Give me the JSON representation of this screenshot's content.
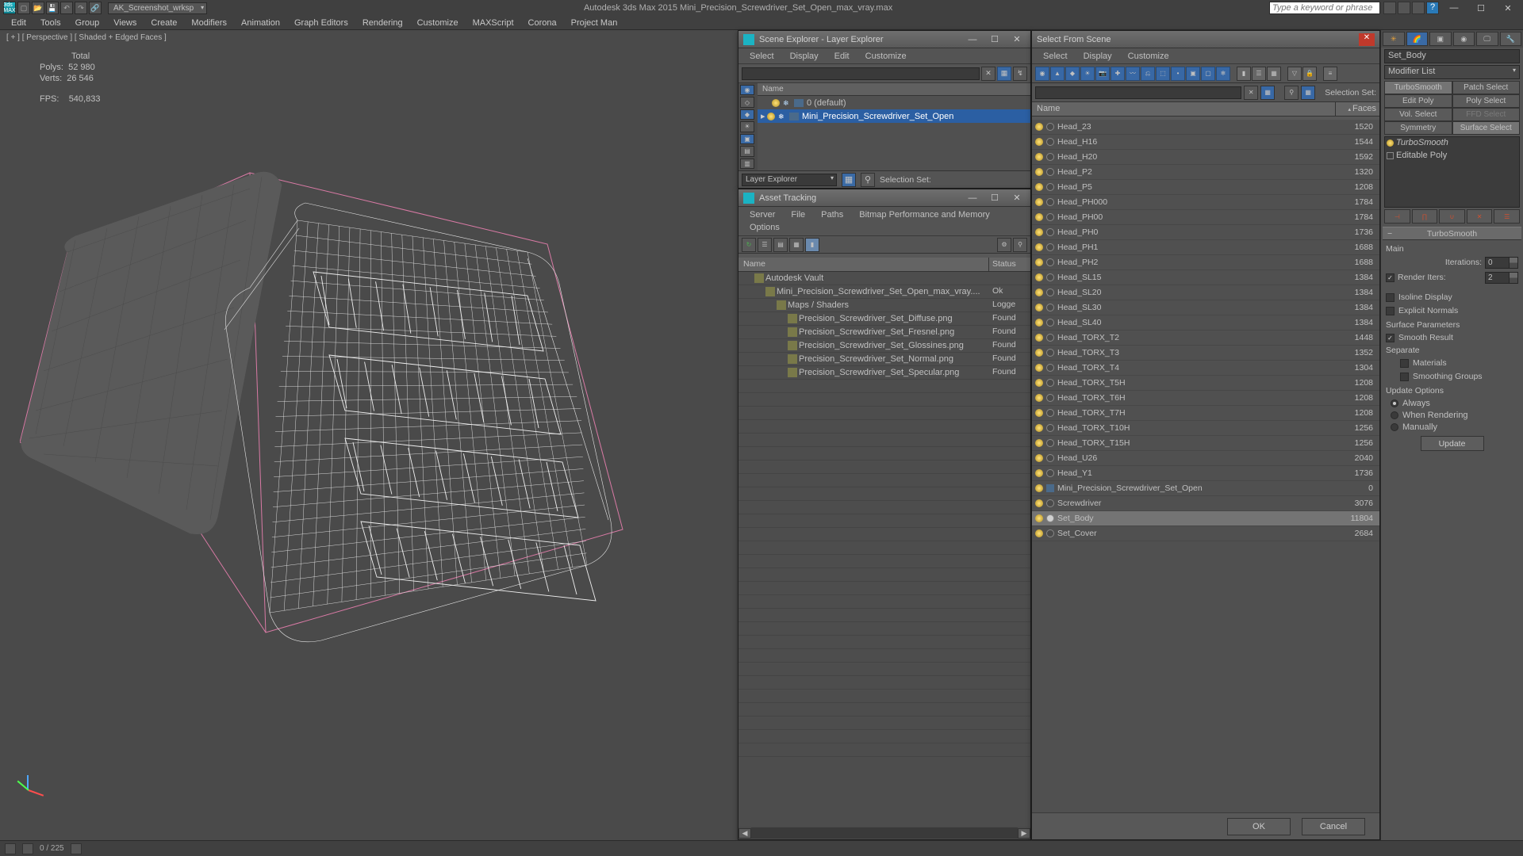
{
  "title_center": "Autodesk 3ds Max  2015     Mini_Precision_Screwdriver_Set_Open_max_vray.max",
  "workspace": "AK_Screenshot_wrksp",
  "search_placeholder": "Type a keyword or phrase",
  "main_menu": [
    "Edit",
    "Tools",
    "Group",
    "Views",
    "Create",
    "Modifiers",
    "Animation",
    "Graph Editors",
    "Rendering",
    "Customize",
    "MAXScript",
    "Corona",
    "Project Man"
  ],
  "viewport_label": "[ + ] [ Perspective ] [ Shaded + Edged Faces ]",
  "stats": {
    "hdr": "Total",
    "polys_l": "Polys:",
    "polys_v": "52 980",
    "verts_l": "Verts:",
    "verts_v": "26 546",
    "fps_l": "FPS:",
    "fps_v": "540,833"
  },
  "scene_explorer": {
    "title": "Scene Explorer - Layer Explorer",
    "menus": [
      "Select",
      "Display",
      "Edit",
      "Customize"
    ],
    "col_name": "Name",
    "rows": [
      {
        "indent": 0,
        "label": "0 (default)",
        "sel": false
      },
      {
        "indent": 0,
        "label": "Mini_Precision_Screwdriver_Set_Open",
        "sel": true
      }
    ],
    "footer_label": "Layer Explorer",
    "selset_label": "Selection Set:"
  },
  "asset_tracking": {
    "title": "Asset Tracking",
    "menus": [
      "Server",
      "File",
      "Paths",
      "Bitmap Performance and Memory",
      "Options"
    ],
    "col_name": "Name",
    "col_status": "Status",
    "rows": [
      {
        "indent": 1,
        "label": "Autodesk Vault",
        "status": "",
        "ico": "vault"
      },
      {
        "indent": 2,
        "label": "Mini_Precision_Screwdriver_Set_Open_max_vray....",
        "status": "Ok",
        "ico": "max"
      },
      {
        "indent": 3,
        "label": "Maps / Shaders",
        "status": "Logge",
        "ico": "folder"
      },
      {
        "indent": 4,
        "label": "Precision_Screwdriver_Set_Diffuse.png",
        "status": "Found",
        "ico": "img"
      },
      {
        "indent": 4,
        "label": "Precision_Screwdriver_Set_Fresnel.png",
        "status": "Found",
        "ico": "img"
      },
      {
        "indent": 4,
        "label": "Precision_Screwdriver_Set_Glossines.png",
        "status": "Found",
        "ico": "img"
      },
      {
        "indent": 4,
        "label": "Precision_Screwdriver_Set_Normal.png",
        "status": "Found",
        "ico": "img"
      },
      {
        "indent": 4,
        "label": "Precision_Screwdriver_Set_Specular.png",
        "status": "Found",
        "ico": "img"
      }
    ]
  },
  "select_from_scene": {
    "title": "Select From Scene",
    "menus": [
      "Select",
      "Display",
      "Customize"
    ],
    "selset_label": "Selection Set:",
    "col_name": "Name",
    "col_faces": "Faces",
    "rows": [
      {
        "name": "Head_23",
        "faces": 1520
      },
      {
        "name": "Head_H16",
        "faces": 1544
      },
      {
        "name": "Head_H20",
        "faces": 1592
      },
      {
        "name": "Head_P2",
        "faces": 1320
      },
      {
        "name": "Head_P5",
        "faces": 1208
      },
      {
        "name": "Head_PH000",
        "faces": 1784
      },
      {
        "name": "Head_PH00",
        "faces": 1784
      },
      {
        "name": "Head_PH0",
        "faces": 1736
      },
      {
        "name": "Head_PH1",
        "faces": 1688
      },
      {
        "name": "Head_PH2",
        "faces": 1688
      },
      {
        "name": "Head_SL15",
        "faces": 1384
      },
      {
        "name": "Head_SL20",
        "faces": 1384
      },
      {
        "name": "Head_SL30",
        "faces": 1384
      },
      {
        "name": "Head_SL40",
        "faces": 1384
      },
      {
        "name": "Head_TORX_T2",
        "faces": 1448
      },
      {
        "name": "Head_TORX_T3",
        "faces": 1352
      },
      {
        "name": "Head_TORX_T4",
        "faces": 1304
      },
      {
        "name": "Head_TORX_T5H",
        "faces": 1208
      },
      {
        "name": "Head_TORX_T6H",
        "faces": 1208
      },
      {
        "name": "Head_TORX_T7H",
        "faces": 1208
      },
      {
        "name": "Head_TORX_T10H",
        "faces": 1256
      },
      {
        "name": "Head_TORX_T15H",
        "faces": 1256
      },
      {
        "name": "Head_U26",
        "faces": 2040
      },
      {
        "name": "Head_Y1",
        "faces": 1736
      },
      {
        "name": "Mini_Precision_Screwdriver_Set_Open",
        "faces": 0,
        "group": true
      },
      {
        "name": "Screwdriver",
        "faces": 3076
      },
      {
        "name": "Set_Body",
        "faces": 11804,
        "sel": true
      },
      {
        "name": "Set_Cover",
        "faces": 2684
      }
    ],
    "ok": "OK",
    "cancel": "Cancel"
  },
  "command_panel": {
    "obj_name": "Set_Body",
    "modlist": "Modifier List",
    "btnrow1": [
      "TurboSmooth",
      "Patch Select"
    ],
    "btnrow2": [
      "Edit Poly",
      "Poly Select"
    ],
    "btnrow3": [
      "Vol. Select",
      "FFD Select"
    ],
    "btnrow4": [
      "Symmetry",
      "Surface Select"
    ],
    "stack": [
      {
        "label": "TurboSmooth",
        "italic": true,
        "bulb": true
      },
      {
        "label": "Editable Poly",
        "italic": false,
        "sq": true
      }
    ],
    "roll_title": "TurboSmooth",
    "main_label": "Main",
    "iter_l": "Iterations:",
    "iter_v": "0",
    "rend_l": "Render Iters:",
    "rend_v": "2",
    "rend_chk": true,
    "iso": "Isoline Display",
    "expn": "Explicit Normals",
    "surf_hdr": "Surface Parameters",
    "smooth": "Smooth Result",
    "smooth_chk": true,
    "sep": "Separate",
    "mat": "Materials",
    "smg": "Smoothing Groups",
    "upd_hdr": "Update Options",
    "r1": "Always",
    "r2": "When Rendering",
    "r3": "Manually",
    "upd_btn": "Update"
  },
  "bottombar": {
    "frames": "0 / 225"
  }
}
